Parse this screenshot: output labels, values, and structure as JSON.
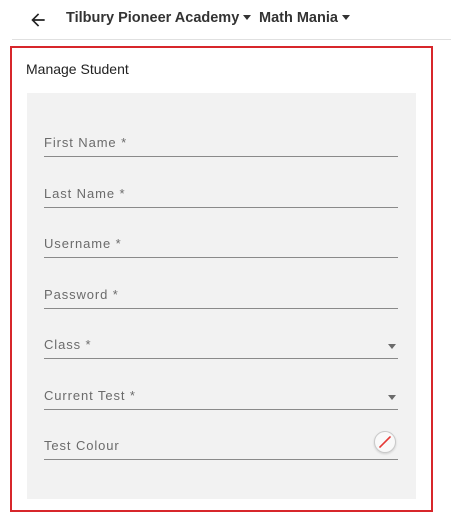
{
  "header": {
    "organization": "Tilbury Pioneer Academy",
    "course": "Math Mania"
  },
  "panel": {
    "title": "Manage Student"
  },
  "form": {
    "first_name_label": "First Name *",
    "last_name_label": "Last Name *",
    "username_label": "Username *",
    "password_label": "Password *",
    "class_label": "Class *",
    "current_test_label": "Current Test *",
    "test_colour_label": "Test Colour"
  },
  "colors": {
    "highlight_border": "#d7262b",
    "form_background": "#f2f2f2",
    "no_colour_slash": "#e53935"
  }
}
